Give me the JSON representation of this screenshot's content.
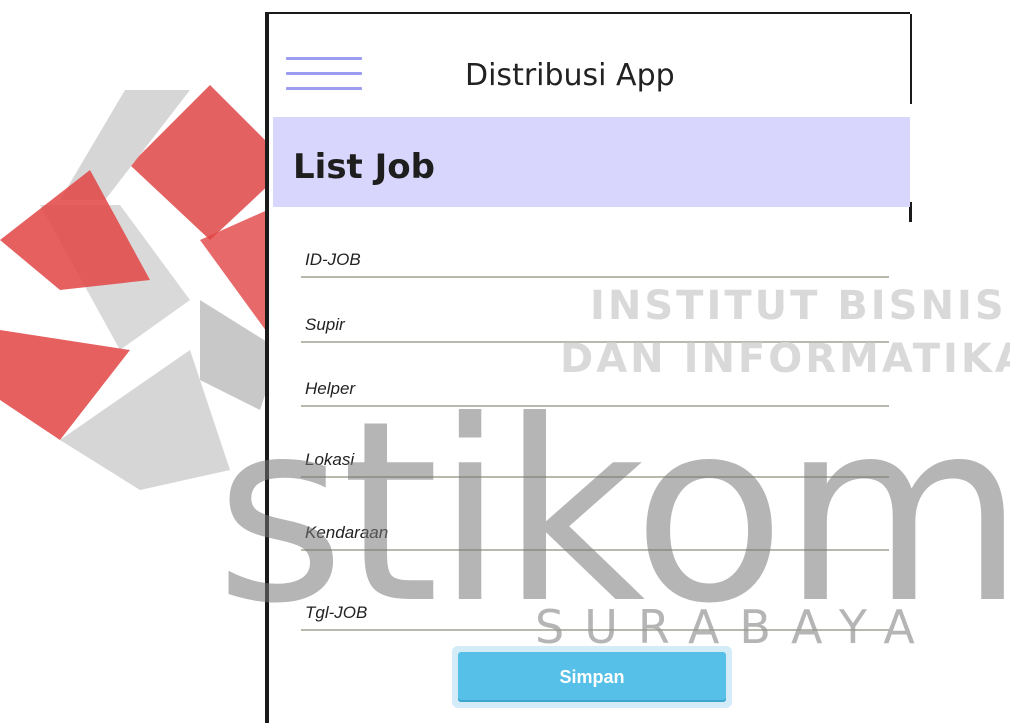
{
  "header": {
    "title": "Distribusi App",
    "menu_icon": "hamburger-menu-icon"
  },
  "section": {
    "title": "List Job"
  },
  "form": {
    "fields": [
      {
        "label": "ID-JOB"
      },
      {
        "label": "Supir"
      },
      {
        "label": "Helper"
      },
      {
        "label": "Lokasi"
      },
      {
        "label": "Kendaraan"
      },
      {
        "label": "Tgl-JOB"
      }
    ],
    "submit_label": "Simpan"
  },
  "watermark": {
    "line1": "INSTITUT BISNIS",
    "line2": "DAN INFORMATIKA",
    "brand": "stikom",
    "city": "SURABAYA"
  },
  "colors": {
    "accent": "#9c9cf0",
    "header_band": "#d8d6fc",
    "button": "#56c0e8",
    "logo_red": "#e23b3b",
    "logo_gray": "#b3b3b3"
  }
}
